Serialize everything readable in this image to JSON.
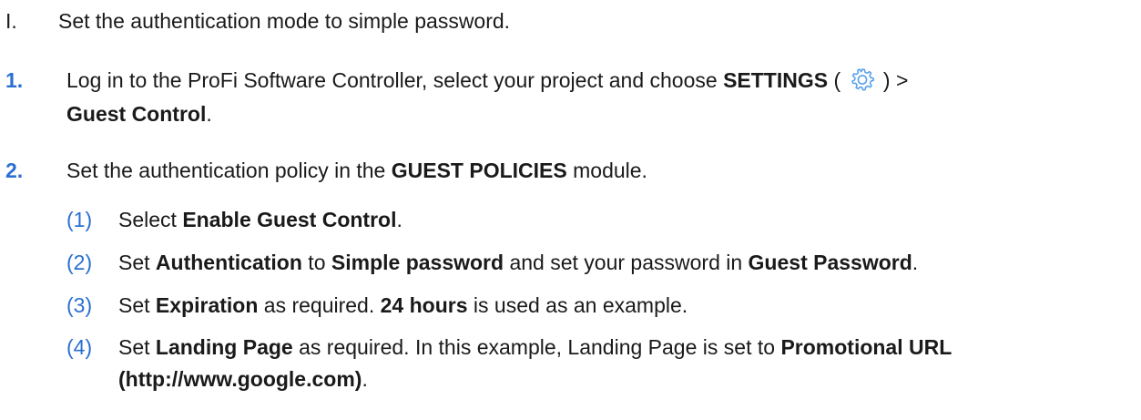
{
  "heading": {
    "marker": "I.",
    "text": "Set the authentication mode to simple password."
  },
  "steps": [
    {
      "marker": "1.",
      "line1_a": "Log in to the ProFi Software Controller, select your project and choose ",
      "line1_b": "SETTINGS",
      "line1_c": " (",
      "line1_d": ") >",
      "line2_a": "Guest Control",
      "line2_b": "."
    },
    {
      "marker": "2.",
      "a": "Set the authentication policy in the ",
      "b": "GUEST POLICIES",
      "c": " module."
    }
  ],
  "substeps": [
    {
      "marker": "(1)",
      "a": "Select ",
      "b": "Enable Guest Control",
      "c": "."
    },
    {
      "marker": "(2)",
      "a": "Set ",
      "b": "Authentication",
      "c": " to ",
      "d": "Simple password",
      "e": " and set your password in ",
      "f": "Guest Password",
      "g": "."
    },
    {
      "marker": "(3)",
      "a": "Set ",
      "b": "Expiration",
      "c": " as required. ",
      "d": "24 hours",
      "e": " is used as an example."
    },
    {
      "marker": "(4)",
      "a": "Set ",
      "b": "Landing Page",
      "c": " as required. In this example, Landing Page is set to ",
      "d": "Promotional URL",
      "line2_a": "(http://www.google.com)",
      "line2_b": "."
    }
  ],
  "colors": {
    "accent": "#2a6fd1",
    "text": "#1a1a1a"
  },
  "icons": {
    "settings": "gear-icon"
  }
}
